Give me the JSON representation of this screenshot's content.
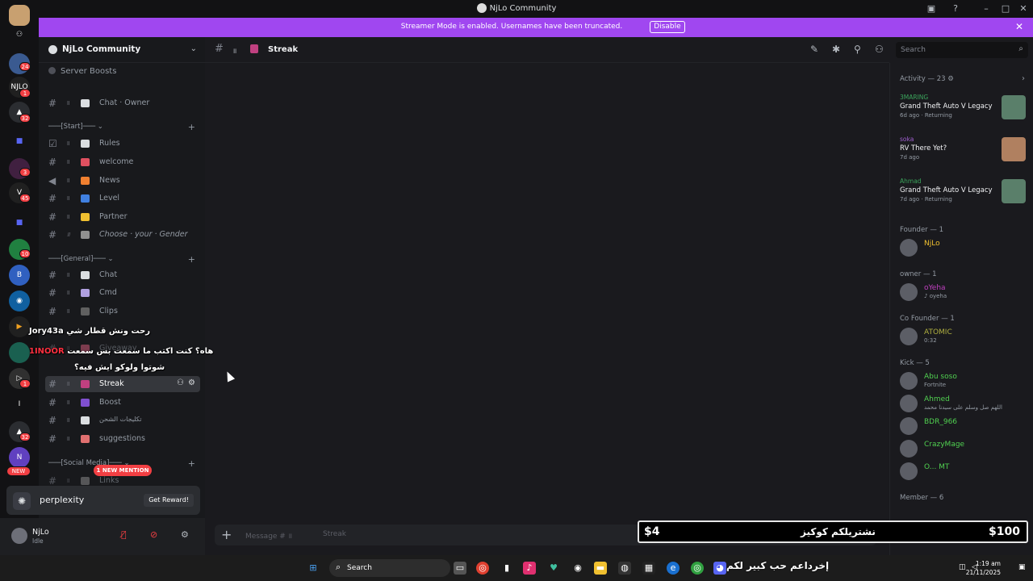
{
  "window": {
    "title": "NjLo Community"
  },
  "banner": {
    "message": "Streamer Mode is enabled. Usernames have been truncated.",
    "button": "Disable"
  },
  "rail": {
    "badges": [
      "24",
      "1",
      "32",
      "3",
      "45",
      "10",
      "1",
      "1",
      "32",
      "1"
    ],
    "new_label": "NEW"
  },
  "sidebar": {
    "guild_name": "NjLo Community",
    "server_boosts": "Server Boosts",
    "top_channel": "Chat · Owner",
    "categories": {
      "start": "───[Start]───",
      "general": "───[General]───",
      "social": "───[Social Media]───"
    },
    "start_channels": [
      "Rules",
      "welcome",
      "News",
      "Level",
      "Partner",
      "Choose · your · Gender"
    ],
    "general_channels": [
      "Chat",
      "Cmd",
      "Clips",
      "Giveaway",
      "Streak",
      "Boost",
      "تكليجات الشحن",
      "suggestions"
    ],
    "social_channels": [
      "Links"
    ],
    "new_mention": "1 NEW MENTION",
    "promo": {
      "name": "perplexity",
      "button": "Get Reward!"
    },
    "user": {
      "name": "NjLo",
      "status": "Idle"
    }
  },
  "stream_chat": [
    {
      "user": "Jory43a",
      "text": "رحت ونش قطار شي"
    },
    {
      "user": "1INOOR",
      "text": "هاه؟ كنت اكتب ما سمعت بس سمعت"
    },
    {
      "user": "",
      "text": "شوتوا ولوكو ايش فيه؟"
    }
  ],
  "main": {
    "channel_name": "Streak",
    "search_placeholder": "Search",
    "composer_placeholder": "Message # ॥",
    "composer_channel": "Streak"
  },
  "right_panel": {
    "activity_header": "Activity — 23",
    "activities": [
      {
        "user": "3MARING",
        "game": "Grand Theft Auto V Legacy",
        "meta": "6d ago · Returning",
        "user_color": "#3ba55c",
        "thumb_color": "#5a7f6a"
      },
      {
        "user": "soka",
        "game": "RV There Yet?",
        "meta": "7d ago",
        "user_color": "#a060d0",
        "thumb_color": "#b08060"
      },
      {
        "user": "Ahmad",
        "game": "Grand Theft Auto V Legacy",
        "meta": "7d ago · Returning",
        "user_color": "#3ba55c",
        "thumb_color": "#5a7f6a"
      }
    ],
    "sections": [
      {
        "title": "Founder — 1",
        "members": [
          {
            "name": "NjLo",
            "status": "",
            "color": "#f0c030"
          }
        ]
      },
      {
        "title": "owner — 1",
        "members": [
          {
            "name": "oYeha",
            "status": "♪ oyeha",
            "color": "#c040c0"
          }
        ]
      },
      {
        "title": "Co Founder — 1",
        "members": [
          {
            "name": "ATOMIC",
            "status": "0:32",
            "color": "#b0b040"
          }
        ]
      },
      {
        "title": "Kick — 5",
        "members": [
          {
            "name": "Abu soso",
            "status": "Fortnite",
            "color": "#50d050"
          },
          {
            "name": "Ahmed",
            "status": "اللهم صل وسلم على سيدنا محمد",
            "color": "#50d050"
          },
          {
            "name": "BDR_966",
            "status": "",
            "color": "#50d050"
          },
          {
            "name": "CrazyMage",
            "status": "",
            "color": "#50d050"
          },
          {
            "name": "O... MT",
            "status": "",
            "color": "#50d050"
          }
        ]
      },
      {
        "title": "Member — 6",
        "members": []
      }
    ]
  },
  "donation": {
    "left": "$4",
    "middle": "نشتريلكم كوكيز",
    "right": "$100"
  },
  "taskbar": {
    "search": "Search",
    "ticker": "إخرداعم حب كبير لكم",
    "time": "1:19 am",
    "date": "21/11/2025"
  },
  "colors": {
    "accent": "#a047f0",
    "danger": "#f23f43",
    "background": "#1a1a1e"
  }
}
